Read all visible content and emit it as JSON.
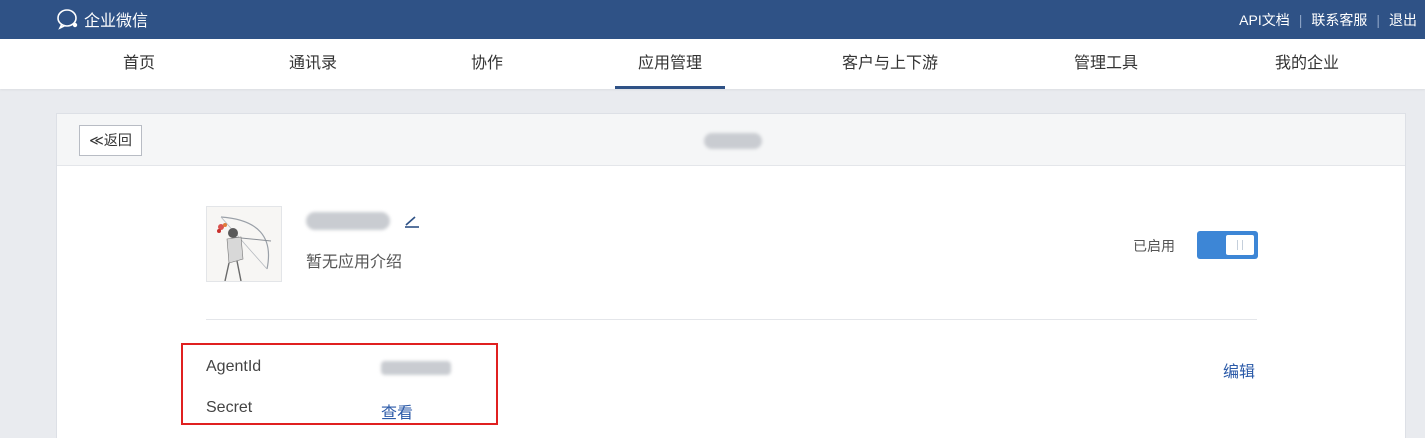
{
  "topbar": {
    "brand": "企业微信",
    "links": [
      "API文档",
      "联系客服",
      "退出"
    ],
    "bg_color": "#2f5286"
  },
  "nav": {
    "items": [
      "首页",
      "通讯录",
      "协作",
      "应用管理",
      "客户与上下游",
      "管理工具",
      "我的企业"
    ],
    "active": "应用管理"
  },
  "header": {
    "back_label": "≪返回"
  },
  "app": {
    "description": "暂无应用介绍",
    "status_label": "已启用",
    "enabled": true,
    "accent_color": "#3d86d6"
  },
  "info": {
    "agentid_label": "AgentId",
    "secret_label": "Secret",
    "secret_action": "查看",
    "edit_label": "编辑"
  }
}
